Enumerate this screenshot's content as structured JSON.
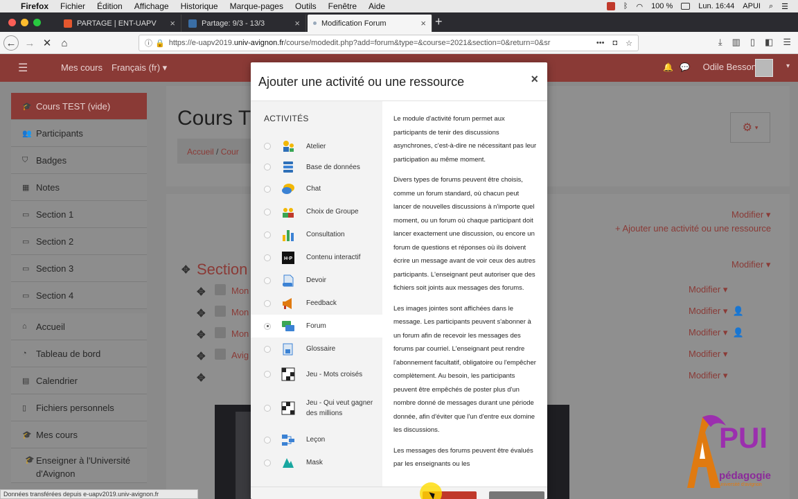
{
  "menubar": {
    "app": "Firefox",
    "items": [
      "Fichier",
      "Édition",
      "Affichage",
      "Historique",
      "Marque-pages",
      "Outils",
      "Fenêtre",
      "Aide"
    ],
    "battery": "100 %",
    "clock": "Lun. 16:44",
    "user": "APUI"
  },
  "tabs": [
    {
      "title": "PARTAGE | ENT-UAPV",
      "color": "#e4572e"
    },
    {
      "title": "Partage: 9/3 - 13/3",
      "color": "#3a6ea5"
    },
    {
      "title": "Modification Forum",
      "color": "#9ab"
    }
  ],
  "urlbar": {
    "prefix": "https://e-uapv2019.",
    "host": "univ-avignon.fr",
    "path": "/course/modedit.php?add=forum&type=&course=2021&section=0&return=0&sr"
  },
  "moodle": {
    "my_courses": "Mes cours",
    "language": "Français (fr)",
    "username": "Odile Besson",
    "course_title": "Cours T",
    "breadcrumb": {
      "home": "Accueil",
      "sep": "/",
      "course": "Cour"
    },
    "edit_label": "Modifier",
    "add_activity": "Ajouter une activité ou une ressource",
    "section_title": "Section",
    "module_links": [
      "Mon",
      "Mon",
      "Mon",
      "Avig"
    ]
  },
  "sidebar": {
    "items": [
      {
        "label": "Cours TEST (vide)",
        "icon": "graduation-cap-icon"
      },
      {
        "label": "Participants",
        "icon": "users-icon"
      },
      {
        "label": "Badges",
        "icon": "shield-icon"
      },
      {
        "label": "Notes",
        "icon": "table-icon"
      },
      {
        "label": "Section 1",
        "icon": "folder-icon"
      },
      {
        "label": "Section 2",
        "icon": "folder-icon"
      },
      {
        "label": "Section 3",
        "icon": "folder-icon"
      },
      {
        "label": "Section 4",
        "icon": "folder-icon"
      },
      {
        "label": "Accueil",
        "icon": "home-icon"
      },
      {
        "label": "Tableau de bord",
        "icon": "dashboard-icon"
      },
      {
        "label": "Calendrier",
        "icon": "calendar-icon"
      },
      {
        "label": "Fichiers personnels",
        "icon": "file-icon"
      },
      {
        "label": "Mes cours",
        "icon": "graduation-cap-icon"
      },
      {
        "label": "Enseigner à l'Université d'Avignon",
        "icon": "graduation-cap-icon"
      }
    ]
  },
  "modal": {
    "title": "Ajouter une activité ou une ressource",
    "close": "×",
    "list_heading": "ACTIVITÉS",
    "activities": [
      {
        "label": "Atelier",
        "icon": "workshop-icon"
      },
      {
        "label": "Base de données",
        "icon": "database-icon"
      },
      {
        "label": "Chat",
        "icon": "chat-icon"
      },
      {
        "label": "Choix de Groupe",
        "icon": "group-choice-icon"
      },
      {
        "label": "Consultation",
        "icon": "chart-icon"
      },
      {
        "label": "Contenu interactif",
        "icon": "h5p-icon"
      },
      {
        "label": "Devoir",
        "icon": "assignment-icon"
      },
      {
        "label": "Feedback",
        "icon": "megaphone-icon"
      },
      {
        "label": "Forum",
        "icon": "forum-icon",
        "selected": true
      },
      {
        "label": "Glossaire",
        "icon": "glossary-icon"
      },
      {
        "label": "Jeu - Mots croisés",
        "icon": "crossword-icon"
      },
      {
        "label": "Jeu - Qui veut gagner des millions",
        "icon": "millionaire-icon"
      },
      {
        "label": "Leçon",
        "icon": "lesson-icon"
      },
      {
        "label": "Mask",
        "icon": "mask-icon"
      }
    ],
    "description": [
      "Le module d'activité forum permet aux participants de tenir des discussions asynchrones, c'est-à-dire ne nécessitant pas leur participation au même moment.",
      "Divers types de forums peuvent être choisis, comme un forum standard, où chacun peut lancer de nouvelles discussions à n'importe quel moment, ou un forum où chaque participant doit lancer exactement une discussion, ou encore un forum de questions et réponses où ils doivent écrire un message avant de voir ceux des autres participants. L'enseignant peut autoriser que des fichiers soit joints aux messages des forums.",
      "Les images jointes sont affichées dans le message. Les participants peuvent s'abonner à un forum afin de recevoir les messages des forums par courriel. L'enseignant peut rendre l'abonnement facultatif, obligatoire ou l'empêcher complètement. Au besoin, les participants peuvent être empêchés de poster plus d'un nombre donné de messages durant une période donnée, afin d'éviter que l'un d'entre eux domine les discussions.",
      "Les messages des forums peuvent être évalués par les enseignants ou les"
    ]
  },
  "status": "Données transférées depuis e-uapv2019.univ-avignon.fr",
  "logo": {
    "word": "PUI",
    "line1": "pédagogie",
    "line2": "université d'avignon"
  },
  "colors": {
    "brand": "#c0392b",
    "firefox_dark": "#2b2b30"
  }
}
